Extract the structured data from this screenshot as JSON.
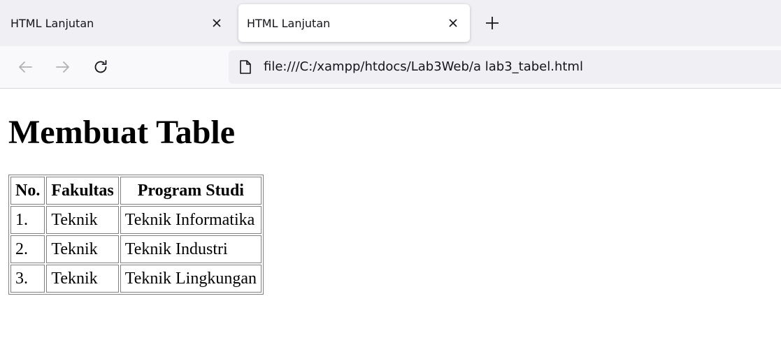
{
  "browser": {
    "tabs": [
      {
        "title": "HTML Lanjutan",
        "active": false
      },
      {
        "title": "HTML Lanjutan",
        "active": true
      }
    ],
    "url": "file:///C:/xampp/htdocs/Lab3Web/a lab3_tabel.html",
    "icons": {
      "tab_close": "close-icon",
      "new_tab": "plus-icon",
      "back": "back-arrow-icon",
      "forward": "forward-arrow-icon",
      "reload": "reload-icon",
      "page": "page-icon"
    }
  },
  "page": {
    "heading": "Membuat Table",
    "table": {
      "headers": [
        "No.",
        "Fakultas",
        "Program Studi"
      ],
      "rows": [
        [
          "1.",
          "Teknik",
          "Teknik Informatika"
        ],
        [
          "2.",
          "Teknik",
          "Teknik Industri"
        ],
        [
          "3.",
          "Teknik",
          "Teknik Lingkungan"
        ]
      ]
    }
  }
}
